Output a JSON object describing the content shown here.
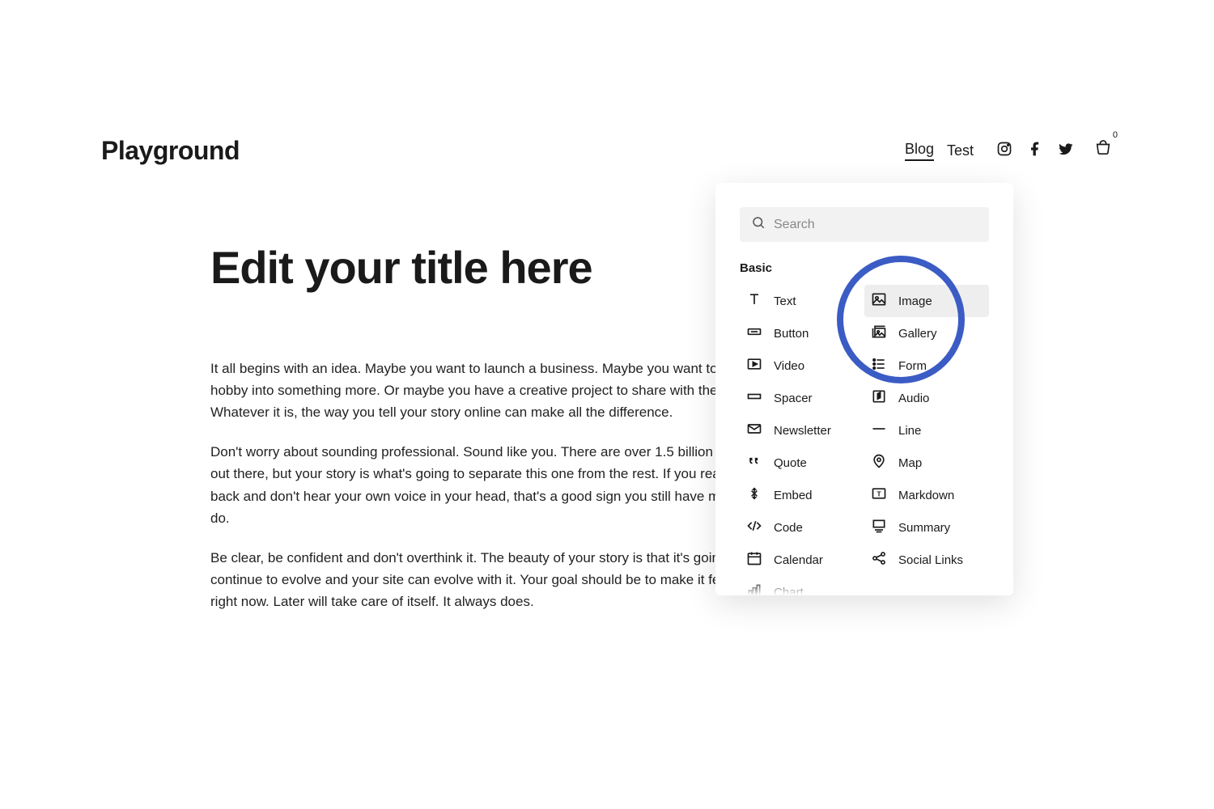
{
  "header": {
    "brand": "Playground",
    "nav": {
      "blog": "Blog",
      "test": "Test"
    },
    "cart_count": "0"
  },
  "content": {
    "title": "Edit your title here",
    "p1": "It all begins with an idea. Maybe you want to launch a business. Maybe you want to turn a hobby into something more. Or maybe you have a creative project to share with the world. Whatever it is, the way you tell your story online can make all the difference.",
    "p2": "Don't worry about sounding professional. Sound like you. There are over 1.5 billion websites out there, but your story is what's going to separate this one from the rest. If you read the words back and don't hear your own voice in your head, that's a good sign you still have more work to do.",
    "p3": "Be clear, be confident and don't overthink it. The beauty of your story is that it's going to continue to evolve and your site can evolve with it. Your goal should be to make it feel right for right now. Later will take care of itself. It always does."
  },
  "panel": {
    "search_placeholder": "Search",
    "section": "Basic",
    "items": {
      "text": "Text",
      "image": "Image",
      "button": "Button",
      "gallery": "Gallery",
      "video": "Video",
      "form": "Form",
      "spacer": "Spacer",
      "audio": "Audio",
      "newsletter": "Newsletter",
      "line": "Line",
      "quote": "Quote",
      "map": "Map",
      "embed": "Embed",
      "markdown": "Markdown",
      "code": "Code",
      "summary": "Summary",
      "calendar": "Calendar",
      "social": "Social Links",
      "chart": "Chart"
    }
  }
}
